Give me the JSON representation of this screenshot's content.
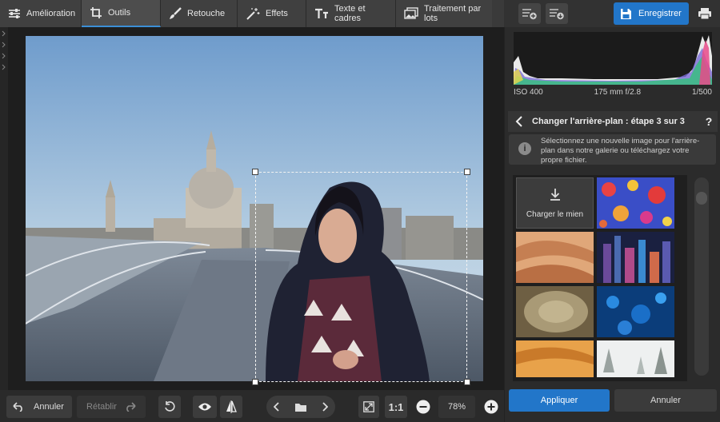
{
  "tabs": [
    {
      "label": "Amélioration",
      "icon": "sliders-icon"
    },
    {
      "label": "Outils",
      "icon": "crop-icon"
    },
    {
      "label": "Retouche",
      "icon": "brush-icon"
    },
    {
      "label": "Effets",
      "icon": "magic-wand-icon"
    },
    {
      "label": "Texte et cadres",
      "icon": "text-icon"
    },
    {
      "label": "Traitement par lots",
      "icon": "batch-images-icon"
    }
  ],
  "active_tab": "Outils",
  "toolbar": {
    "save_label": "Enregistrer"
  },
  "histogram": {
    "iso": "ISO 400",
    "lens": "175 mm f/2.8",
    "shutter": "1/500"
  },
  "panel": {
    "step_title": "Changer l'arrière-plan : étape 3 sur 3",
    "help": "?",
    "info_text": "Sélectionnez une nouvelle image pour l'arrière-plan dans notre galerie ou téléchargez votre propre fichier.",
    "info_icon": "i",
    "load_label": "Charger le mien",
    "apply_label": "Appliquer",
    "cancel_label": "Annuler"
  },
  "bottom": {
    "undo_label": "Annuler",
    "redo_label": "Rétablir",
    "ratio_label": "1:1",
    "zoom_value": "78%"
  },
  "colors": {
    "accent": "#2276c9",
    "background": "#2b2b2b",
    "tab_active": "#4d4d4d"
  }
}
